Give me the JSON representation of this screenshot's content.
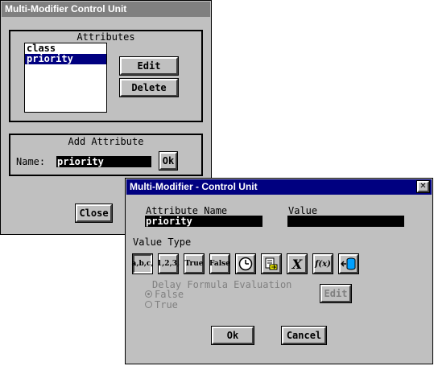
{
  "back_window": {
    "title": "Multi-Modifier Control Unit",
    "attributes_group_title": "Attributes",
    "attribute_list": [
      {
        "label": "class",
        "selected": false
      },
      {
        "label": "priority",
        "selected": true
      }
    ],
    "edit_label": "Edit",
    "delete_label": "Delete",
    "add_group_title": "Add Attribute",
    "name_label": "Name:",
    "name_value": "priority",
    "ok_label": "Ok",
    "close_label": "Close"
  },
  "front_window": {
    "title": "Multi-Modifier - Control Unit",
    "close_glyph": "✕",
    "attribute_name_label": "Attribute Name",
    "attribute_name_value": "priority",
    "value_label": "Value",
    "value_value": "",
    "value_type_label": "Value Type",
    "value_types": [
      {
        "name": "string-type-icon",
        "text": "a,b,c,",
        "pressed": true
      },
      {
        "name": "number-type-icon",
        "text": "1,2,3,",
        "pressed": false
      },
      {
        "name": "true-type-icon",
        "text": "True",
        "pressed": false
      },
      {
        "name": "false-type-icon",
        "text": "False",
        "pressed": false
      },
      {
        "name": "clock-icon",
        "text": "",
        "pressed": false
      },
      {
        "name": "file-icon",
        "text": "",
        "pressed": false
      },
      {
        "name": "x-variable-icon",
        "text": "X",
        "pressed": false
      },
      {
        "name": "function-icon",
        "text": "f(x)",
        "pressed": false
      },
      {
        "name": "database-icon",
        "text": "",
        "pressed": false
      }
    ],
    "delay_label": "Delay Formula Evaluation",
    "false_label": "False",
    "true_label": "True",
    "edit_label": "Edit",
    "ok_label": "Ok",
    "cancel_label": "Cancel"
  },
  "colors": {
    "back_title_bg": "#808080",
    "front_title_bg": "#000080",
    "window_bg": "#c0c0c0",
    "selection": "#000080"
  }
}
